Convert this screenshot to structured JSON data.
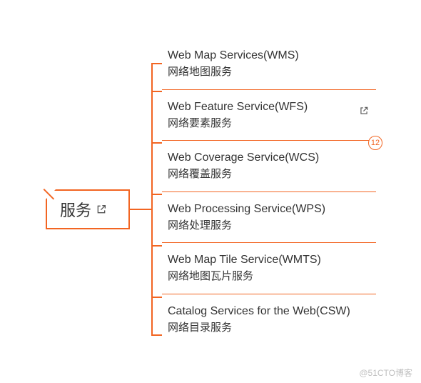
{
  "colors": {
    "accent": "#f26522",
    "text": "#333333",
    "watermark": "#bfbfbf"
  },
  "root": {
    "label": "服务",
    "has_external_icon": true
  },
  "branch_badge": "12",
  "children": [
    {
      "en": "Web Map Services(WMS)",
      "zh": "网络地图服务",
      "external": false
    },
    {
      "en": "Web Feature Service(WFS)",
      "zh": "网络要素服务",
      "external": true
    },
    {
      "en": "Web Coverage Service(WCS)",
      "zh": "网络覆盖服务",
      "external": false
    },
    {
      "en": "Web Processing Service(WPS)",
      "zh": "网络处理服务",
      "external": false
    },
    {
      "en": "Web Map Tile Service(WMTS)",
      "zh": "网络地图瓦片服务",
      "external": false
    },
    {
      "en": "Catalog Services for the Web(CSW)",
      "zh": "网络目录服务",
      "external": false
    }
  ],
  "watermark": "@51CTO博客"
}
